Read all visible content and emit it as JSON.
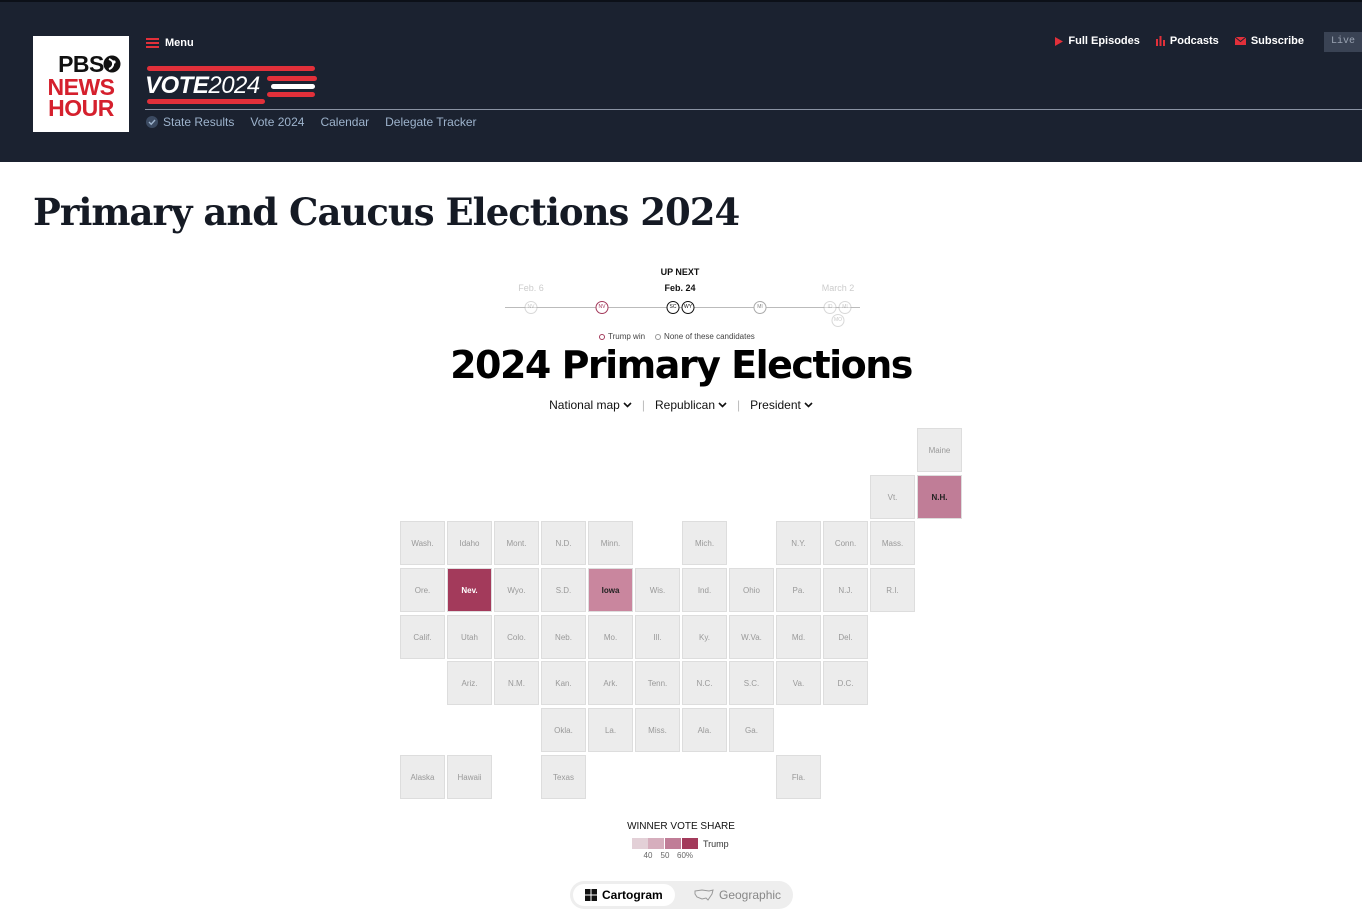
{
  "header": {
    "logo": {
      "line1": "PBS",
      "line2": "NEWS",
      "line3": "HOUR"
    },
    "menu_label": "Menu",
    "vote_logo": {
      "word": "VOTE",
      "year": "2024"
    },
    "right_links": [
      {
        "label": "Full Episodes",
        "icon": "play-icon"
      },
      {
        "label": "Podcasts",
        "icon": "bars-icon"
      },
      {
        "label": "Subscribe",
        "icon": "envelope-icon"
      }
    ],
    "live_label": "Live",
    "subnav": [
      {
        "label": "State Results",
        "icon": "check-icon"
      },
      {
        "label": "Vote 2024"
      },
      {
        "label": "Calendar"
      },
      {
        "label": "Delegate Tracker"
      }
    ]
  },
  "page_title": "Primary and Caucus Elections 2024",
  "timeline": {
    "up_next_label": "UP NEXT",
    "dates": {
      "left": "Feb. 6",
      "center": "Feb. 24",
      "right": "March 2"
    },
    "stops": [
      "NV",
      "NV",
      "SC",
      "WY",
      "MI",
      "ID",
      "MI",
      "MO"
    ],
    "legend": {
      "trump_win": "Trump win",
      "none": "None of these candidates"
    }
  },
  "map": {
    "title": "2024 Primary Elections",
    "dropdowns": {
      "view": "National map",
      "party": "Republican",
      "office": "President"
    },
    "colors": {
      "empty": "#ececec",
      "nev": "#a33a5b",
      "iowa": "#c9869e",
      "nh": "#c07d97"
    },
    "states": {
      "maine": "Maine",
      "vt": "Vt.",
      "nh": "N.H.",
      "wash": "Wash.",
      "idaho": "Idaho",
      "mont": "Mont.",
      "nd": "N.D.",
      "minn": "Minn.",
      "mich": "Mich.",
      "ny": "N.Y.",
      "conn": "Conn.",
      "mass": "Mass.",
      "ore": "Ore.",
      "nev": "Nev.",
      "wyo": "Wyo.",
      "sd": "S.D.",
      "iowa": "Iowa",
      "wis": "Wis.",
      "ind": "Ind.",
      "ohio": "Ohio",
      "pa": "Pa.",
      "nj": "N.J.",
      "ri": "R.I.",
      "calif": "Calif.",
      "utah": "Utah",
      "colo": "Colo.",
      "neb": "Neb.",
      "mo": "Mo.",
      "ill": "Ill.",
      "ky": "Ky.",
      "wva": "W.Va.",
      "md": "Md.",
      "del": "Del.",
      "ariz": "Ariz.",
      "nm": "N.M.",
      "kan": "Kan.",
      "ark": "Ark.",
      "tenn": "Tenn.",
      "nc": "N.C.",
      "sc": "S.C.",
      "va": "Va.",
      "dc": "D.C.",
      "okla": "Okla.",
      "la": "La.",
      "miss": "Miss.",
      "ala": "Ala.",
      "ga": "Ga.",
      "alaska": "Alaska",
      "hawaii": "Hawaii",
      "texas": "Texas",
      "fla": "Fla."
    },
    "legend": {
      "title": "WINNER VOTE SHARE",
      "candidate": "Trump",
      "ticks": [
        "40",
        "50",
        "60%"
      ],
      "swatch_colors": [
        "#e3d0d7",
        "#d6aebd",
        "#c07d97",
        "#a33a5b"
      ]
    },
    "toggle": {
      "cartogram": "Cartogram",
      "geographic": "Geographic"
    }
  }
}
